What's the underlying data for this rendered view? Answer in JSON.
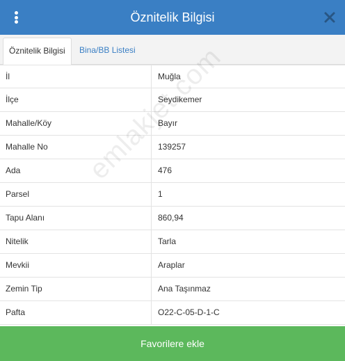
{
  "header": {
    "title": "Öznitelik Bilgisi"
  },
  "tabs": [
    {
      "label": "Öznitelik Bilgisi",
      "active": true
    },
    {
      "label": "Bina/BB Listesi",
      "active": false
    }
  ],
  "attributes": [
    {
      "key": "İl",
      "value": "Muğla"
    },
    {
      "key": "İlçe",
      "value": "Seydikemer"
    },
    {
      "key": "Mahalle/Köy",
      "value": "Bayır"
    },
    {
      "key": "Mahalle No",
      "value": "139257"
    },
    {
      "key": "Ada",
      "value": "476"
    },
    {
      "key": "Parsel",
      "value": "1"
    },
    {
      "key": "Tapu Alanı",
      "value": "860,94"
    },
    {
      "key": "Nitelik",
      "value": "Tarla"
    },
    {
      "key": "Mevkii",
      "value": "Araplar"
    },
    {
      "key": "Zemin Tip",
      "value": "Ana Taşınmaz"
    },
    {
      "key": "Pafta",
      "value": "O22-C-05-D-1-C"
    }
  ],
  "watermark": "emlakjet.com",
  "actions": {
    "favorite_label": "Favorilere ekle"
  },
  "colors": {
    "header": "#3a7fc4",
    "button": "#5cb85c",
    "link": "#3a7fc4"
  }
}
